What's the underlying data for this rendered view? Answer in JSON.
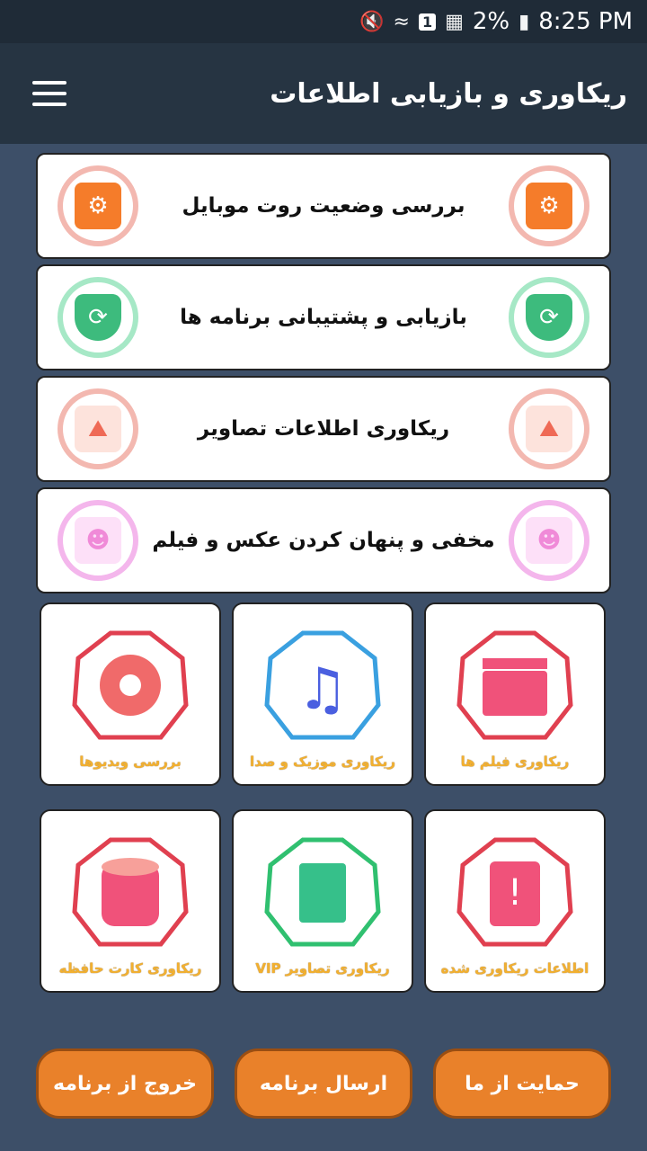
{
  "status_bar": {
    "battery": "2%",
    "time": "8:25 PM",
    "sim_badge": "1",
    "icons": [
      "mute-icon",
      "wifi-icon",
      "sim-icon",
      "signal-icon",
      "battery-icon"
    ]
  },
  "app_bar": {
    "title": "ریکاوری و بازیابی اطلاعات",
    "menu_icon": "hamburger-menu-icon"
  },
  "rows": [
    {
      "label": "بررسی وضعیت روت موبایل",
      "icon": "chip-icon",
      "color": "#f57c2a",
      "ring": "#f0a8a0"
    },
    {
      "label": "بازیابی و پشتیبانی برنامه ها",
      "icon": "shield-backup-icon",
      "color": "#3dbb7d",
      "ring": "#8fe0b8"
    },
    {
      "label": "ریکاوری اطلاعات تصاویر",
      "icon": "image-icon",
      "color": "#ef7a66",
      "ring": "#f0a8a0"
    },
    {
      "label": "مخفی و پنهان کردن عکس و فیلم",
      "icon": "mask-icon",
      "color": "#f4a8e8",
      "ring": "#f2a6e8"
    }
  ],
  "tiles": [
    {
      "caption": "ریکاوری فیلم ها",
      "icon": "clapperboard-icon",
      "color": "#f0527a",
      "glow": "#e04050"
    },
    {
      "caption": "ریکاوری موزیک و صدا",
      "icon": "music-note-icon",
      "color": "#4a5fe0",
      "glow": "#3aa0e0"
    },
    {
      "caption": "بررسی ویدیوها",
      "icon": "film-reel-icon",
      "color": "#f06a6a",
      "glow": "#e04050"
    },
    {
      "caption": "اطلاعات ریکاوری شده",
      "icon": "hard-drive-alert-icon",
      "color": "#f0527a",
      "glow": "#e04050"
    },
    {
      "caption": "ریکاوری تصاویر VIP",
      "icon": "file-restore-icon",
      "color": "#36c08a",
      "glow": "#30c070"
    },
    {
      "caption": "ریکاوری کارت حافظه",
      "icon": "database-restore-icon",
      "color": "#f0527a",
      "glow": "#e04050"
    }
  ],
  "buttons": {
    "support": "حمایت از ما",
    "share": "ارسال برنامه",
    "exit": "خروج از برنامه"
  }
}
